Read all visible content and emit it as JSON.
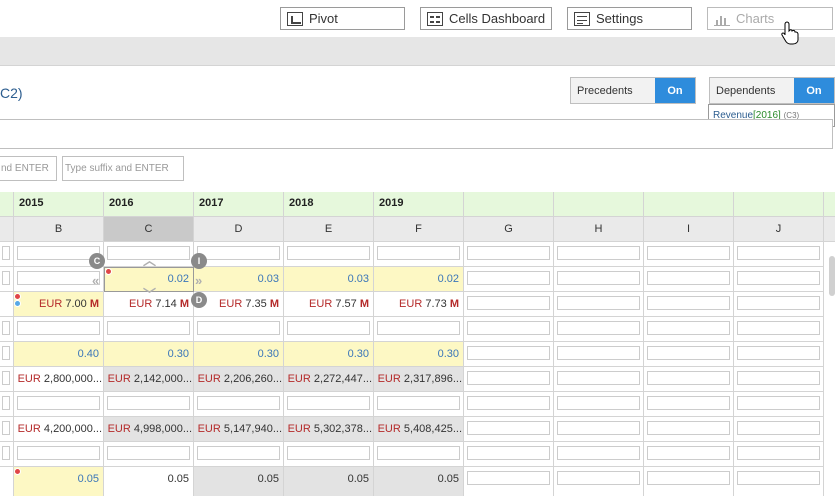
{
  "toolbar": {
    "pivot": "Pivot",
    "dashboard": "Cells Dashboard",
    "settings": "Settings",
    "charts": "Charts"
  },
  "formula": {
    "title_fragment": "C2)"
  },
  "precedents": {
    "label": "Precedents",
    "state": "On"
  },
  "dependents": {
    "label": "Dependents",
    "state": "On",
    "item": {
      "name": "Revenue",
      "year": "[2016]",
      "ref": "(C3)"
    }
  },
  "affix": {
    "prefix_placeholder": "nd ENTER",
    "suffix_placeholder": "Type suffix and ENTER"
  },
  "grid": {
    "years": [
      "2015",
      "2016",
      "2017",
      "2018",
      "2019",
      "",
      "",
      "",
      ""
    ],
    "columns": [
      "B",
      "C",
      "D",
      "E",
      "F",
      "G",
      "H",
      "I",
      "J"
    ],
    "selected_column": "C",
    "rows": {
      "r2": [
        "",
        "0.02",
        "0.03",
        "0.03",
        "0.02"
      ],
      "r3": [
        {
          "cur": "EUR",
          "num": "7.00",
          "unit": "M"
        },
        {
          "cur": "EUR",
          "num": "7.14",
          "unit": "M"
        },
        {
          "cur": "EUR",
          "num": "7.35",
          "unit": "M"
        },
        {
          "cur": "EUR",
          "num": "7.57",
          "unit": "M"
        },
        {
          "cur": "EUR",
          "num": "7.73",
          "unit": "M"
        }
      ],
      "r5": [
        "0.40",
        "0.30",
        "0.30",
        "0.30",
        "0.30"
      ],
      "r6": [
        {
          "cur": "EUR",
          "num": "2,800,000..."
        },
        {
          "cur": "EUR",
          "num": "2,142,000..."
        },
        {
          "cur": "EUR",
          "num": "2,206,260..."
        },
        {
          "cur": "EUR",
          "num": "2,272,447..."
        },
        {
          "cur": "EUR",
          "num": "2,317,896..."
        }
      ],
      "r8": [
        {
          "cur": "EUR",
          "num": "4,200,000..."
        },
        {
          "cur": "EUR",
          "num": "4,998,000..."
        },
        {
          "cur": "EUR",
          "num": "5,147,940..."
        },
        {
          "cur": "EUR",
          "num": "5,302,378..."
        },
        {
          "cur": "EUR",
          "num": "5,408,425..."
        }
      ],
      "r10": [
        "0.05",
        "0.05",
        "0.05",
        "0.05",
        "0.05"
      ]
    },
    "handles": {
      "left": "C",
      "top": "I",
      "bottom": "D"
    }
  },
  "colors": {
    "accent": "#2e8cdc",
    "header_green": "#e6f8dc",
    "highlight_yellow": "#fdf8c4",
    "currency_red": "#b52a2a",
    "percent_blue": "#3b76b9"
  }
}
